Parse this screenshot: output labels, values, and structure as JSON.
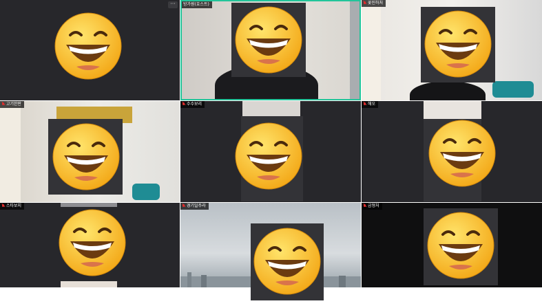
{
  "participants": [
    {
      "name": "",
      "active": false
    },
    {
      "name": "방가원(호스트)",
      "active": true
    },
    {
      "name": "꽃진하처",
      "active": false
    },
    {
      "name": "고기한판",
      "active": false
    },
    {
      "name": "수수보리",
      "active": false
    },
    {
      "name": "해오",
      "active": false
    },
    {
      "name": "스타보지",
      "active": false
    },
    {
      "name": "경기일주라",
      "active": false
    },
    {
      "name": "금형처",
      "active": false
    }
  ],
  "more_label": "···",
  "colors": {
    "active_border": "#22c59a",
    "tile_bg": "#27272b",
    "mic_muted": "#e02d2d"
  },
  "icons": [
    "microphone-muted-icon",
    "more-options-icon",
    "grinning-emoji-icon"
  ]
}
